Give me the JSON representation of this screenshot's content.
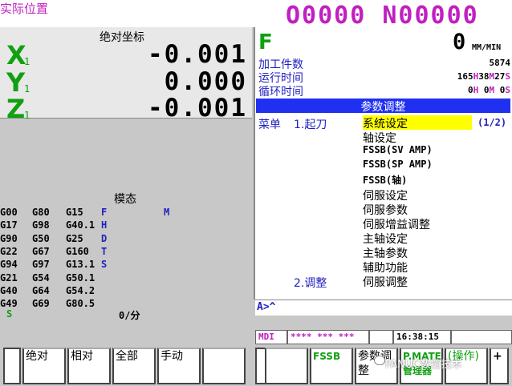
{
  "header": {
    "title": "实际位置",
    "program": "O0000 N00000"
  },
  "absolute": {
    "title": "绝对坐标",
    "axes": [
      {
        "name": "X",
        "sub": "1",
        "value": "-0.001"
      },
      {
        "name": "Y",
        "sub": "1",
        "value": "0.000"
      },
      {
        "name": "Z",
        "sub": "1",
        "value": "-0.001"
      }
    ]
  },
  "modal": {
    "title": "模态",
    "rows": [
      [
        "G00",
        "G80",
        "G15",
        "F",
        "",
        "M"
      ],
      [
        "G17",
        "G98",
        "G40.1",
        "H",
        "",
        ""
      ],
      [
        "G90",
        "G50",
        "G25",
        "D",
        "",
        ""
      ],
      [
        "G22",
        "G67",
        "G160",
        "T",
        "",
        ""
      ],
      [
        "G94",
        "G97",
        "G13.1",
        "S",
        "",
        ""
      ],
      [
        "G21",
        "G54",
        "G50.1",
        "",
        "",
        ""
      ],
      [
        "G40",
        "G64",
        "G54.2",
        "",
        "",
        ""
      ],
      [
        "G49",
        "G69",
        "G80.5",
        "",
        "",
        ""
      ]
    ],
    "s_label": "S",
    "feed_unit": "0/分"
  },
  "feed": {
    "letter": "F",
    "value": "0",
    "unit": "MM/MIN"
  },
  "info": {
    "parts_label": "加工件数",
    "parts_value": "5874",
    "run_label": "运行时间",
    "run_h": "165",
    "run_h_unit": "H",
    "run_m": "38",
    "run_m_unit": "M",
    "run_s": "27",
    "run_s_unit": "S",
    "cycle_label": "循环时间",
    "cycle_h": "0",
    "cycle_h_unit": "H",
    "cycle_m": "0",
    "cycle_m_unit": "M",
    "cycle_s": "0",
    "cycle_s_unit": "S"
  },
  "menu": {
    "title": "参数调整",
    "label": "菜单",
    "cat1": "1.起刀",
    "cat2": "2.调整",
    "page": "(1/2)",
    "items": [
      "系统设定",
      "轴设定",
      "FSSB(SV AMP)",
      "FSSB(SP AMP)",
      "FSSB(轴)",
      "伺服设定",
      "伺服参数",
      "伺服增益调整",
      "主轴设定",
      "主轴参数",
      "辅助功能",
      "伺服调整"
    ]
  },
  "input": {
    "prompt": "A>^"
  },
  "status": {
    "mode": "MDI",
    "stars": "**** *** ***",
    "time": "16:38:15"
  },
  "softkeys": {
    "left": [
      "绝对",
      "相对",
      "全部",
      "手动",
      ""
    ],
    "right": [
      "",
      "FSSB",
      "参数调整",
      "P.MATE管理器",
      "(操作)"
    ],
    "right_edge": "+"
  },
  "watermark": "FANUC数控技术"
}
